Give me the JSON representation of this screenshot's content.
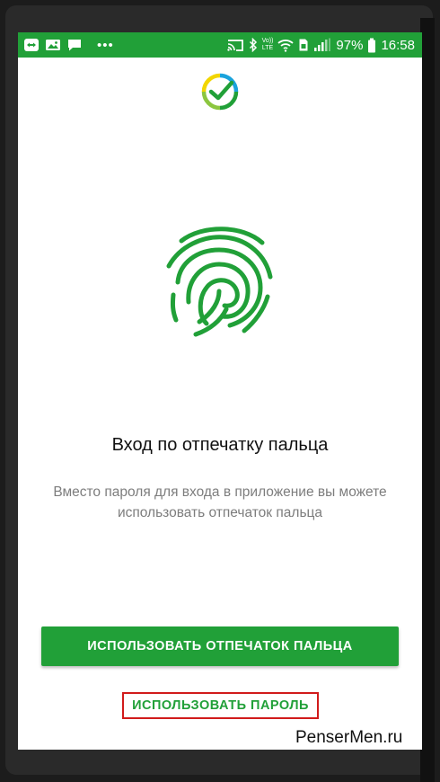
{
  "status_bar": {
    "battery_percent": "97%",
    "time": "16:58",
    "lte_label_top": "Vo))",
    "lte_label_bottom": "LTE"
  },
  "screen": {
    "title": "Вход по отпечатку пальца",
    "description": "Вместо пароля для входа в приложение вы можете использовать отпечаток пальца",
    "primary_button_label": "ИСПОЛЬЗОВАТЬ ОТПЕЧАТОК ПАЛЬЦА",
    "password_link_label": "ИСПОЛЬЗОВАТЬ ПАРОЛЬ"
  },
  "watermark": "PenserMen.ru",
  "colors": {
    "brand_green": "#21a038",
    "highlight_red": "#d11b1b",
    "text_secondary": "#7d7d7d"
  }
}
